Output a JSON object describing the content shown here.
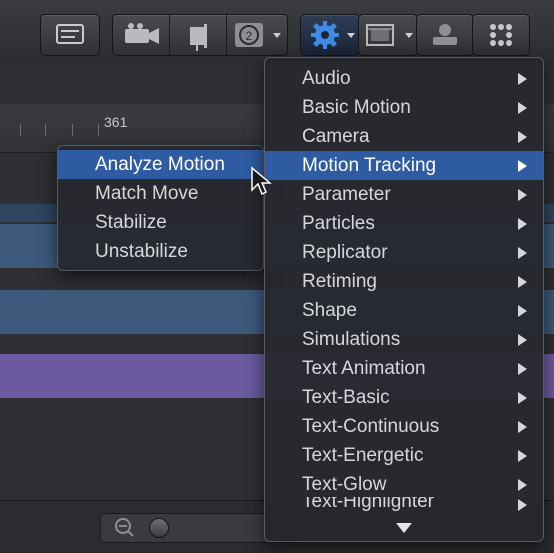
{
  "ruler": {
    "label": "361"
  },
  "main_menu": {
    "items": [
      {
        "label": "Audio"
      },
      {
        "label": "Basic Motion"
      },
      {
        "label": "Camera"
      },
      {
        "label": "Motion Tracking"
      },
      {
        "label": "Parameter"
      },
      {
        "label": "Particles"
      },
      {
        "label": "Replicator"
      },
      {
        "label": "Retiming"
      },
      {
        "label": "Shape"
      },
      {
        "label": "Simulations"
      },
      {
        "label": "Text Animation"
      },
      {
        "label": "Text-Basic"
      },
      {
        "label": "Text-Continuous"
      },
      {
        "label": "Text-Energetic"
      },
      {
        "label": "Text-Glow"
      },
      {
        "label": "Text-Highlighter"
      }
    ],
    "selected_index": 3
  },
  "sub_menu": {
    "items": [
      {
        "label": "Analyze Motion"
      },
      {
        "label": "Match Move"
      },
      {
        "label": "Stabilize"
      },
      {
        "label": "Unstabilize"
      }
    ],
    "selected_index": 0
  },
  "toolbar": {
    "icons": [
      "inspector-icon",
      "camera-icon",
      "light-icon",
      "generator-icon",
      "behaviors-gear-icon",
      "filters-icon",
      "replicator-icon",
      "make-particles-icon"
    ]
  },
  "colors": {
    "accent": "#2e5ba1",
    "track_blue": "#3d5a7c",
    "track_purple": "#6b5aa0"
  }
}
